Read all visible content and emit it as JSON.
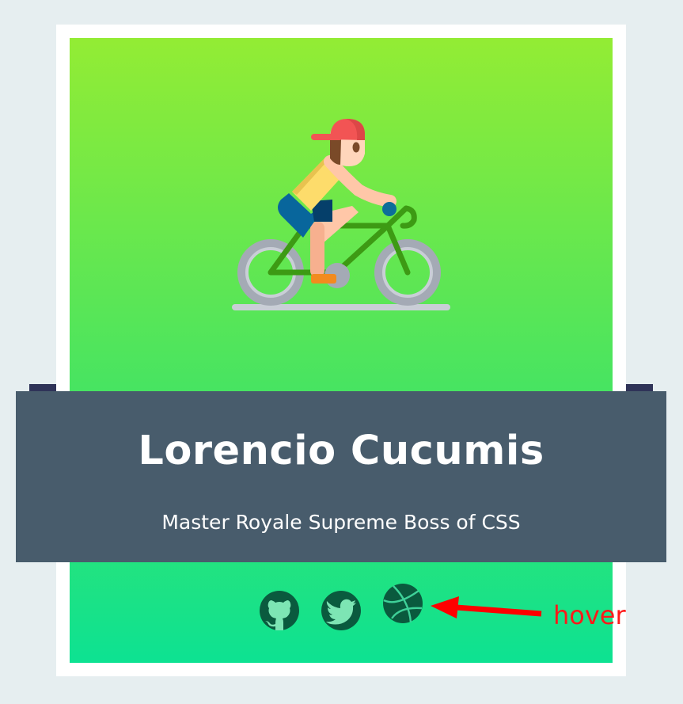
{
  "profile": {
    "name": "Lorencio Cucumis",
    "role": "Master Royale Supreme Boss of CSS"
  },
  "social_links": [
    {
      "name": "github",
      "icon": "github-icon"
    },
    {
      "name": "twitter",
      "icon": "twitter-icon"
    },
    {
      "name": "dribbble",
      "icon": "dribbble-icon",
      "state": "hover"
    }
  ],
  "annotation": {
    "text": "hover",
    "color": "#ff0000"
  },
  "colors": {
    "gradient_top": "#93ec34",
    "gradient_bottom": "#0de292",
    "banner": "#485c6c",
    "icon": "#0a5a3e",
    "frame": "#ffffff",
    "background": "#e6eef0"
  }
}
